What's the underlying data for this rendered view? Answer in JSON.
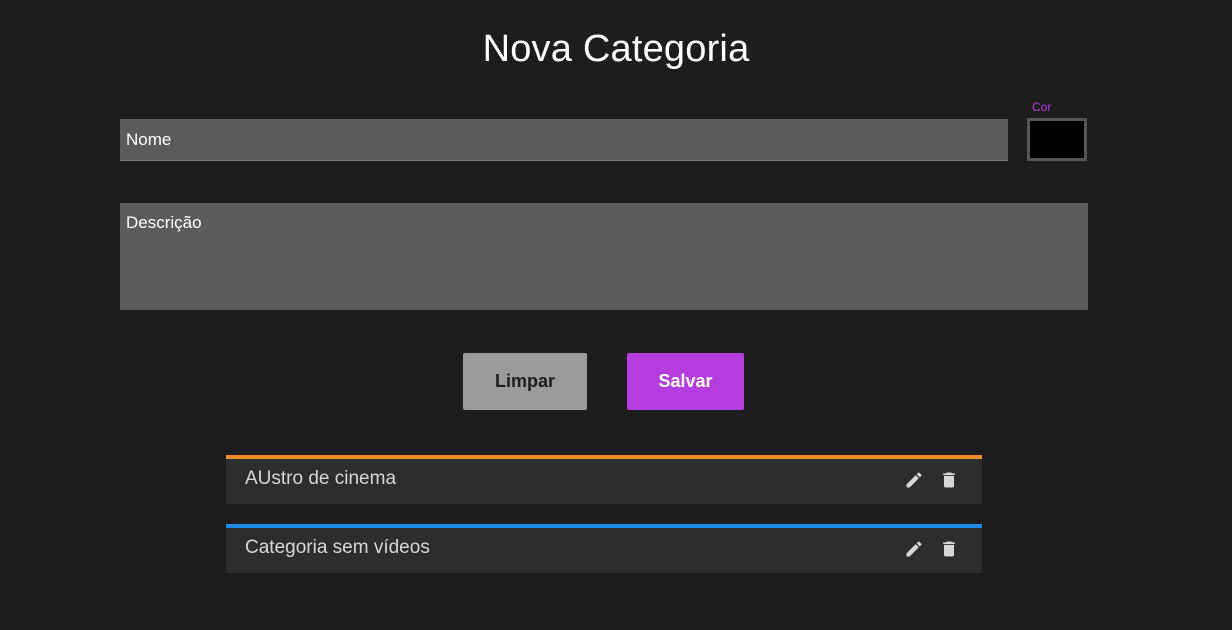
{
  "form": {
    "title": "Nova Categoria",
    "nome_placeholder": "Nome",
    "cor_label": "Cor",
    "cor_value": "#000000",
    "descricao_placeholder": "Descrição"
  },
  "actions": {
    "limpar_label": "Limpar",
    "salvar_label": "Salvar"
  },
  "categories": [
    {
      "name": "AUstro de cinema",
      "color": "#f08a24",
      "edit_icon": "pencil-icon",
      "delete_icon": "trash-icon"
    },
    {
      "name": "Categoria sem vídeos",
      "color": "#1e88e5",
      "edit_icon": "pencil-icon",
      "delete_icon": "trash-icon"
    }
  ],
  "colors": {
    "background": "#1d1d1d",
    "input_bg": "#5b5b5e",
    "accent": "#b53de0",
    "secondary_button": "#9b9b9b",
    "list_item_bg": "#2d2d2d"
  }
}
